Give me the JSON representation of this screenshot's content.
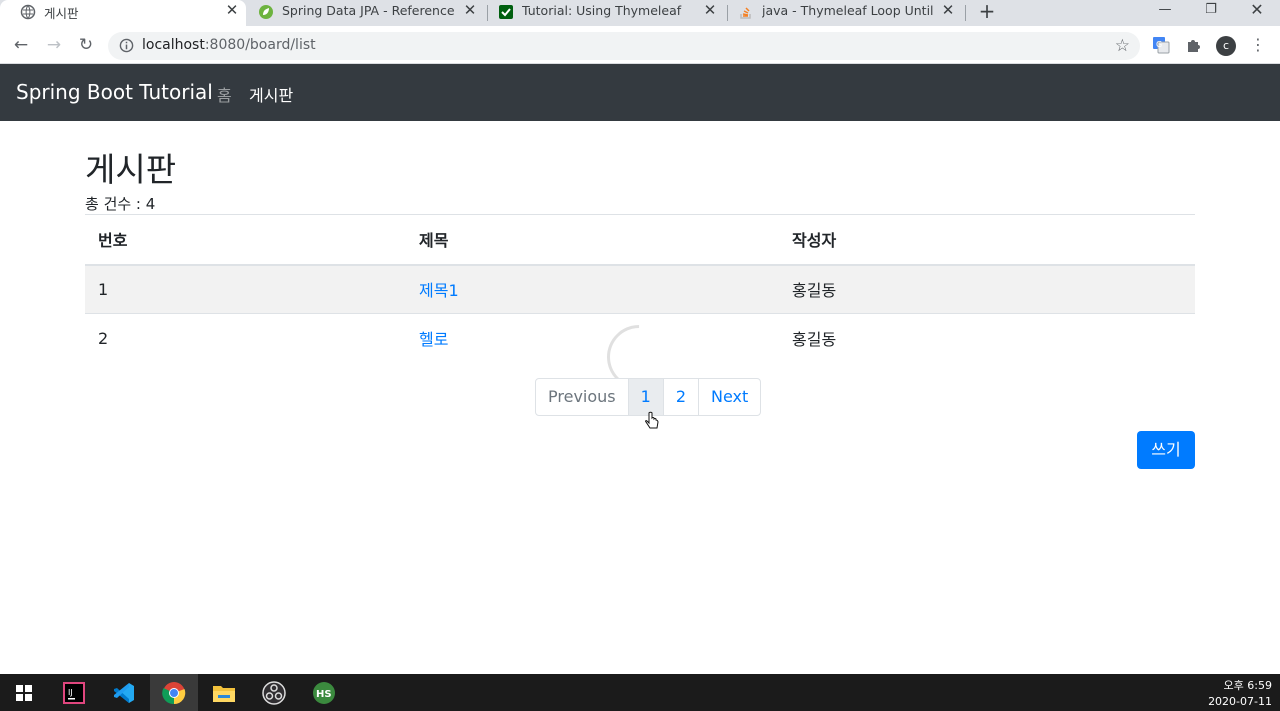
{
  "browser": {
    "tabs": [
      {
        "title": "게시판",
        "active": true
      },
      {
        "title": "Spring Data JPA - Reference Do",
        "active": false
      },
      {
        "title": "Tutorial: Using Thymeleaf",
        "active": false
      },
      {
        "title": "java - Thymeleaf Loop Until a N",
        "active": false
      }
    ],
    "url_host": "localhost",
    "url_rest": ":8080/board/list"
  },
  "navbar": {
    "brand": "Spring Boot Tutorial",
    "links": [
      {
        "label": "홈"
      },
      {
        "label": "게시판"
      }
    ]
  },
  "page": {
    "title": "게시판",
    "total_label": "총 건수 : 4",
    "table": {
      "headers": [
        "번호",
        "제목",
        "작성자"
      ],
      "rows": [
        {
          "no": "1",
          "title": "제목1",
          "author": "홍길동"
        },
        {
          "no": "2",
          "title": "헬로",
          "author": "홍길동"
        }
      ]
    },
    "pagination": {
      "previous": "Previous",
      "pages": [
        "1",
        "2"
      ],
      "current": "1",
      "next": "Next"
    },
    "write_button": "쓰기"
  },
  "taskbar": {
    "time": "오후 6:59",
    "date": "2020-07-11"
  },
  "colors": {
    "navbar": "#343a40",
    "link": "#007bff",
    "button": "#007bff"
  }
}
